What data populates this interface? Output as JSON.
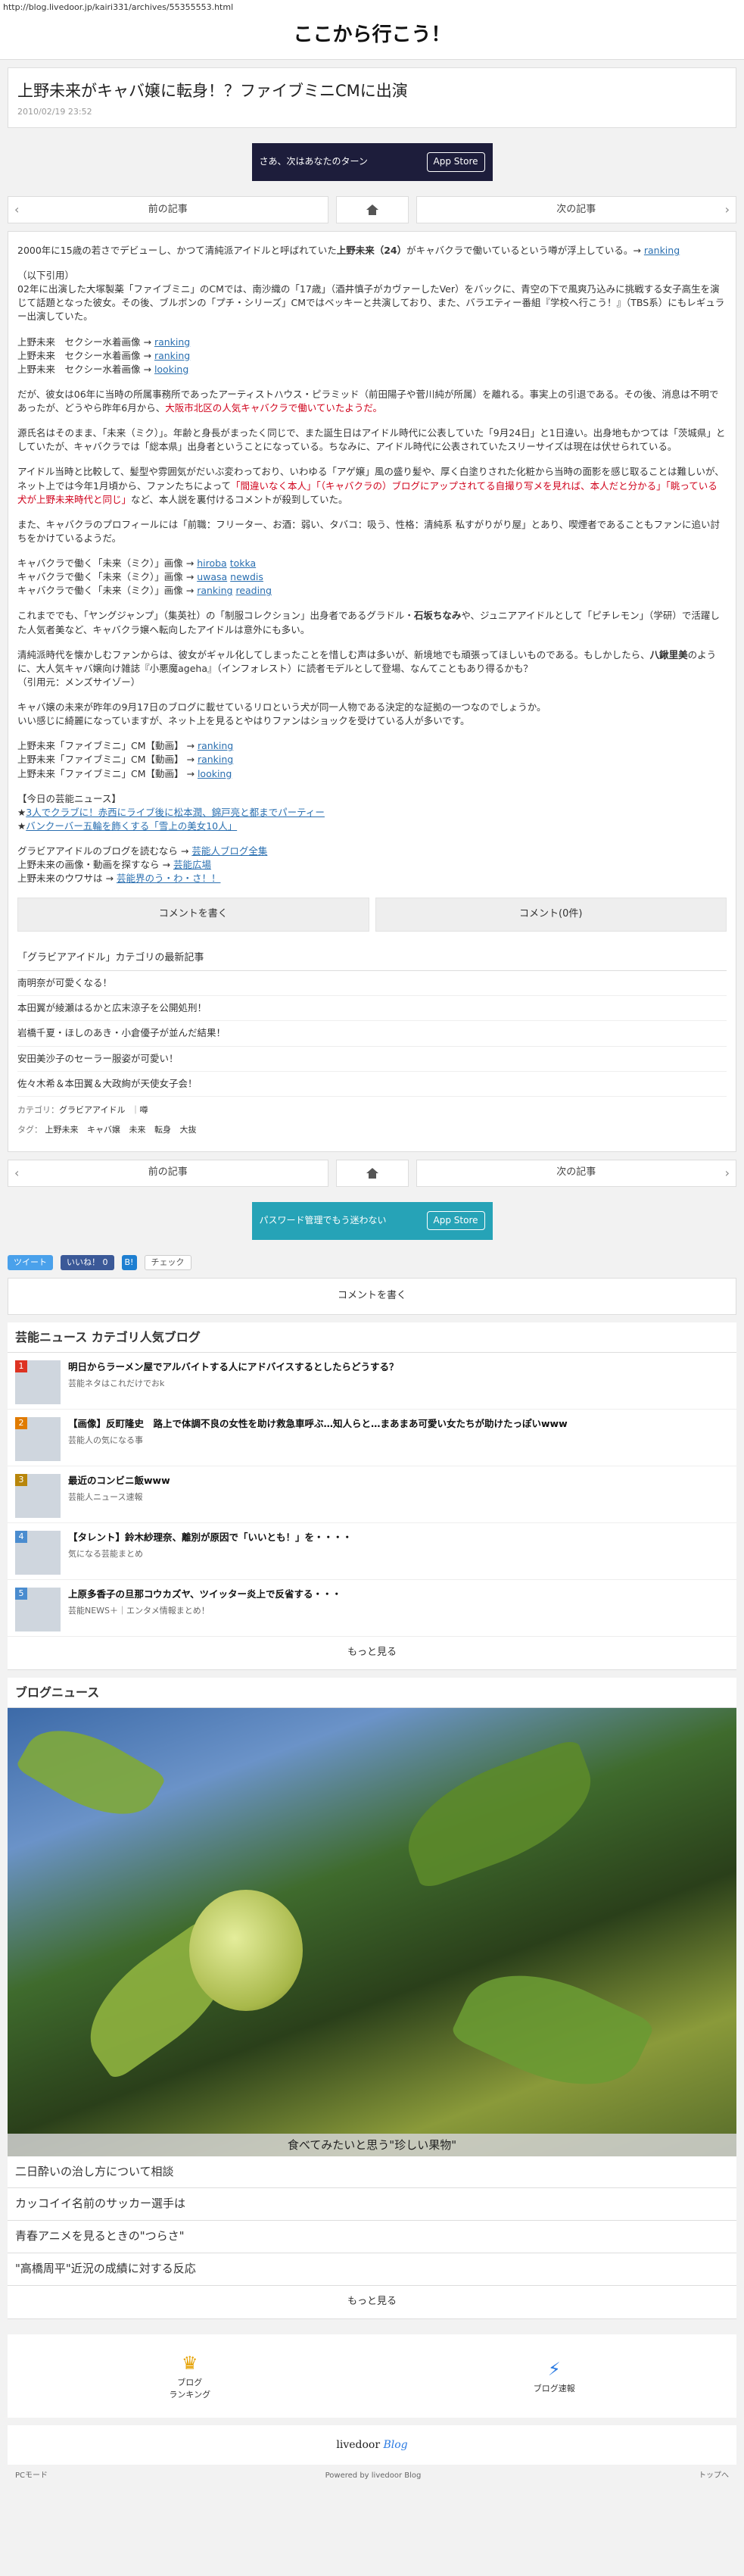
{
  "url": "http://blog.livedoor.jp/kairi331/archives/55355553.html",
  "site_title": "ここから行こう！",
  "post": {
    "title": "上野未来がキャバ嬢に転身！？ファイブミニCMに出演",
    "date": "2010/02/19 23:52"
  },
  "ad1": {
    "text": "さあ、次はあなたのターン",
    "store": "App Store"
  },
  "ad2": {
    "text": "パスワード管理でもう迷わない",
    "store": "App Store"
  },
  "pager": {
    "prev": "前の記事",
    "next": "次の記事"
  },
  "article": {
    "p1a": "2000年に15歳の若さでデビューし、かつて清純派アイドルと呼ばれていた",
    "p1name": "上野未来（24）",
    "p1b": "がキャバクラで働いているという噂が浮上している。→",
    "p1link": "ranking",
    "p2": "（以下引用）",
    "p2a": "02年に出演した大塚製薬「ファイブミニ」のCMでは、南沙織の「17歳」（酒井慎子がカヴァーしたVer）をバックに、青空の下で風爽乃込みに挑戦する女子高生を演じて話題となった彼女。その後、ブルボンの「プチ・シリーズ」CMではベッキーと共演しており、また、バラエティー番組『学校へ行こう！』（TBS系）にもレギュラー出演していた。",
    "l1": "上野未来　セクシー水着画像 →",
    "l1link": "ranking",
    "l2": "上野未来　セクシー水着画像 →",
    "l2link": "ranking",
    "l3": "上野未来　セクシー水着画像 →",
    "l3link": "looking",
    "p3a": "だが、彼女は06年に当時の所属事務所であったアーティストハウス・ピラミッド（前田陽子や菅川純が所属）を離れる。事実上の引退である。その後、消息は不明であったが、どうやら昨年6月から、",
    "p3red": "大阪市北区の人気キャバクラで働いていたようだ。",
    "p4": "源氏名はそのまま、「未来（ミク）」。年齢と身長がまったく同じで、また誕生日はアイドル時代に公表していた「9月24日」と1日違い。出身地もかつては「茨城県」としていたが、キャバクラでは「総本県」出身者ということになっている。ちなみに、アイドル時代に公表されていたスリーサイズは現在は伏せられている。",
    "p5a": "アイドル当時と比較して、髪型や雰囲気がだいぶ変わっており、いわゆる「アゲ嬢」風の盛り髪や、厚く白塗りされた化粧から当時の面影を感じ取ることは難しいが、ネット上では今年1月頃から、ファンたちによって",
    "p5red": "「間違いなく本人」「（キャバクラの）ブログにアップされてる自撮り写メを見れば、本人だと分かる」「眺っている犬が上野未来時代と同じ」",
    "p5b": "など、本人説を裏付けるコメントが殺到していた。",
    "p6": "また、キャバクラのプロフィールには「前職：フリーター、お酒：弱い、タバコ：吸う、性格：清純系 私すがりがり屋」とあり、喫煙者であることもファンに追い討ちをかけているようだ。",
    "l4": "キャバクラで働く「未来（ミク）」画像 →",
    "l4link1": "hiroba",
    "l4link2": "tokka",
    "l5": "キャバクラで働く「未来（ミク）」画像 →",
    "l5link1": "uwasa",
    "l5link2": "newdis",
    "l6": "キャバクラで働く「未来（ミク）」画像 →",
    "l6link1": "ranking",
    "l6link2": "reading",
    "p7a": "これまででも、「ヤングジャンプ」（集英社）の「制服コレクション」出身者であるグラドル・",
    "p7name": "石坂ちなみ",
    "p7b": "や、ジュニアアイドルとして「ピチレモン」（学研）で活躍した人気者美など、キャバクラ嬢へ転向したアイドルは意外にも多い。",
    "p8a": "清純派時代を懐かしむファンからは、彼女がギャル化してしまったことを惜しむ声は多いが、新境地でも頑張ってほしいものである。もしかしたら、",
    "p8name": "八鍬里美",
    "p8b": "のように、大人気キャバ嬢向け雑誌『小悪魔ageha』（インフォレスト）に読者モデルとして登場、なんてこともあり得るかも？",
    "p8src": "（引用元：メンズサイゾー）",
    "p9": "キャバ嬢の未来が昨年の9月17日のブログに載せているリロという犬が同一人物である決定的な証拠の一つなのでしょうか。",
    "p9b": "いい感じに綺麗になっていますが、ネット上を見るとやはりファンはショックを受けている人が多いです。",
    "l7": "上野未来「ファイブミニ」CM【動画】 →",
    "l7link": "ranking",
    "l8": "上野未来「ファイブミニ」CM【動画】 →",
    "l8link": "ranking",
    "l9": "上野未来「ファイブミニ」CM【動画】 →",
    "l9link": "looking",
    "today": "【今日の芸能ニュース】",
    "t1": "3人でクラブに！赤西にライブ後に松本潤、錦戸亮と都までパーティー",
    "t2": "バンクーバー五輪を飾くする「雪上の美女10人」",
    "g1": "グラビアアイドルのブログを読むなら →",
    "g1link": "芸能人ブログ全集",
    "g2": "上野未来の画像・動画を探すなら →",
    "g2link": "芸能広場",
    "g3": "上野未来のウワサは →",
    "g3link": "芸能界のう・わ・さ！！"
  },
  "buttons": {
    "write_comment": "コメントを書く",
    "comments": "コメント(0件)"
  },
  "category": {
    "heading": "「グラビアアイドル」カテゴリの最新記事",
    "items": [
      "南明奈が可愛くなる！",
      "本田翼が綾瀬はるかと広末涼子を公開処刑！",
      "岩橋千夏・ほしのあき・小倉優子が並んだ結果！",
      "安田美沙子のセーラー服姿が可愛い！",
      "佐々木希＆本田翼＆大政絢が天使女子会！"
    ],
    "cat_label": "カテゴリ：",
    "cat_name": "グラビアアイドル",
    "cat_sep": "｜",
    "cat_extra": "噂",
    "tag_label": "タグ：",
    "tags": [
      "上野未来",
      "キャバ嬢",
      "未来",
      "転身",
      "大抜"
    ]
  },
  "social": {
    "tweet": "ツイート",
    "like": "いいね！ 0",
    "check": "チェック"
  },
  "ranking": {
    "title": "芸能ニュース カテゴリ人気ブログ",
    "items": [
      {
        "num": "1",
        "title": "明日からラーメン屋でアルバイトする人にアドバイスするとしたらどうする？",
        "src": "芸能ネタはこれだけでおk"
      },
      {
        "num": "2",
        "title": "【画像】反町隆史　路上で体調不良の女性を助け救急車呼ぶ…知人らと…まあまあ可愛い女たちが助けたっぽいwww",
        "src": "芸能人の気になる事"
      },
      {
        "num": "3",
        "title": "最近のコンビニ飯www",
        "src": "芸能人ニュース速報"
      },
      {
        "num": "4",
        "title": "【タレント】鈴木紗理奈、離別が原因で「いいとも！」を・・・・",
        "src": "気になる芸能まとめ"
      },
      {
        "num": "5",
        "title": "上原多香子の旦那コウカズヤ、ツイッター炎上で反省する・・・",
        "src": "芸能NEWS＋｜エンタメ情報まとめ！"
      }
    ],
    "more": "もっと見る"
  },
  "blog_news": {
    "title": "ブログニュース",
    "caption": "食べてみたいと思う\"珍しい果物\"",
    "items": [
      "二日酔いの治し方について相談",
      "カッコイイ名前のサッカー選手は",
      "青春アニメを見るときの\"つらさ\"",
      "\"高橋周平\"近況の成績に対する反応"
    ],
    "more": "もっと見る"
  },
  "footer": {
    "nav1": "ブログ\nランキング",
    "nav2": "ブログ速報",
    "logo_a": "livedoor",
    "logo_b": "Blog",
    "pc": "PCモード",
    "powered": "Powered by livedoor Blog",
    "top": "トップへ"
  }
}
